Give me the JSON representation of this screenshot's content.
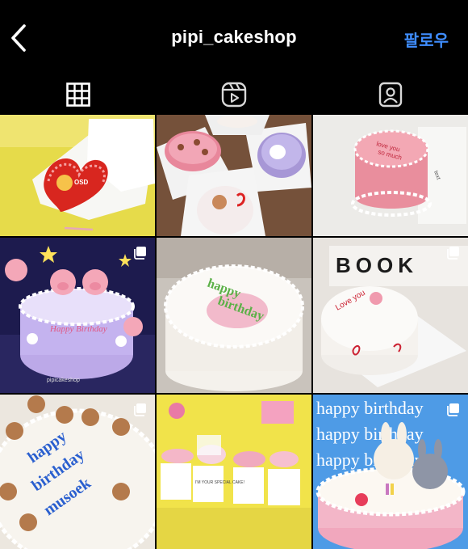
{
  "header": {
    "title": "pipi_cakeshop",
    "follow_label": "팔로우",
    "back_icon": "chevron-left-icon"
  },
  "tabs": [
    {
      "icon": "grid-icon",
      "active": true
    },
    {
      "icon": "reels-icon",
      "active": false
    },
    {
      "icon": "tagged-icon",
      "active": false
    }
  ],
  "posts": [
    {
      "name": "red-heart-cake-in-box",
      "multi": false
    },
    {
      "name": "assorted-mini-cakes",
      "multi": false
    },
    {
      "name": "pink-lettering-cake",
      "multi": false
    },
    {
      "name": "pig-birthday-cake",
      "multi": true,
      "caption": "Happy Birthday",
      "watermark": "pipicakeshop"
    },
    {
      "name": "green-happy-birthday-cake",
      "multi": false
    },
    {
      "name": "love-you-cake-with-book",
      "multi": true,
      "book_text": "BOOK"
    },
    {
      "name": "bear-cake-blue-lettering",
      "multi": true
    },
    {
      "name": "special-cake-boxes",
      "multi": false,
      "box_text": "I'M YOUR SPECIAL CAKE!"
    },
    {
      "name": "bunny-happy-birthday-cake",
      "multi": true,
      "banner_text": "happy birthday"
    }
  ],
  "colors": {
    "accent": "#3f8dff",
    "background": "#000000"
  }
}
